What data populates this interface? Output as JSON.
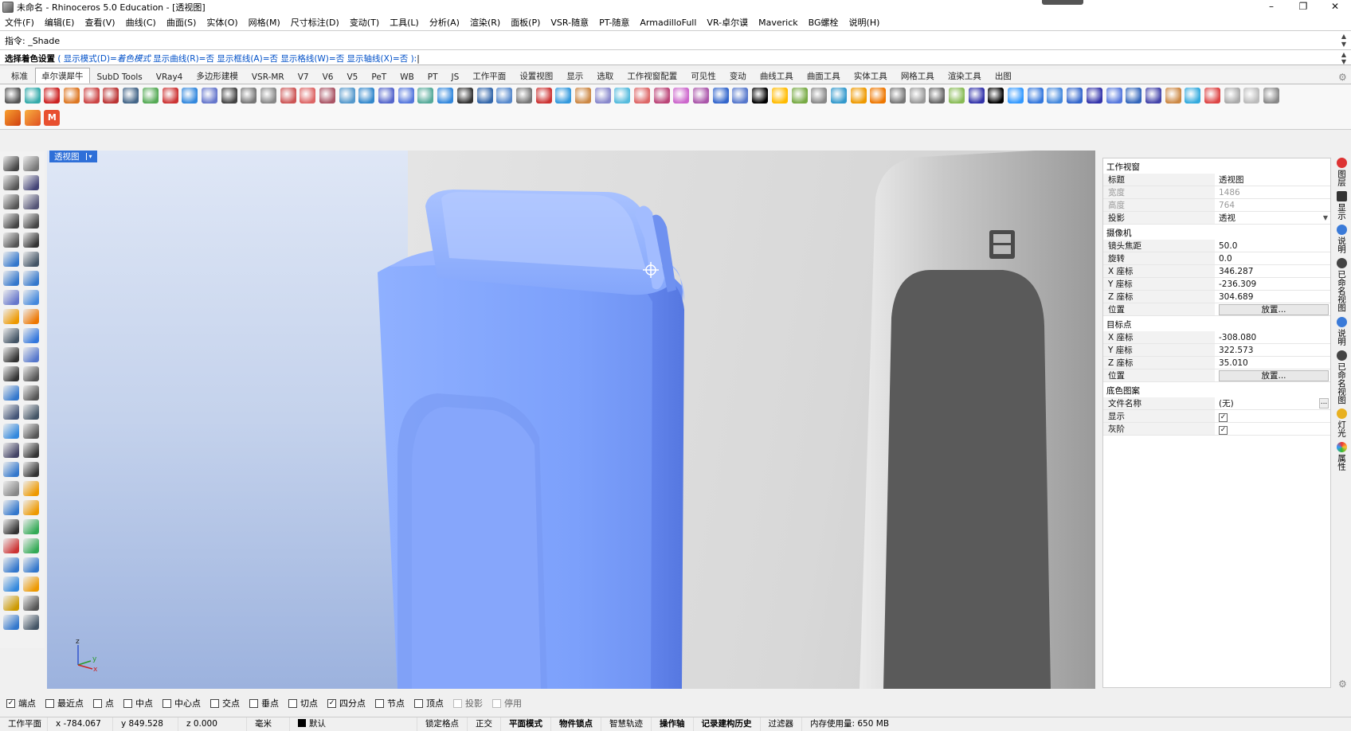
{
  "window": {
    "title": "未命名 - Rhinoceros 5.0 Education - [透视图]",
    "min": "–",
    "restore": "❐",
    "close": "✕"
  },
  "menu": [
    "文件(F)",
    "编辑(E)",
    "查看(V)",
    "曲线(C)",
    "曲面(S)",
    "实体(O)",
    "网格(M)",
    "尺寸标注(D)",
    "变动(T)",
    "工具(L)",
    "分析(A)",
    "渲染(R)",
    "面板(P)",
    "VSR-随意",
    "PT-随意",
    "ArmadilloFull",
    "VR-卓尔谟",
    "Maverick",
    "BG螺栓",
    "说明(H)"
  ],
  "command": {
    "history": "指令: _Shade",
    "prompt_label": "选择着色设置",
    "prompt_open": " ( 显示模式(D)=",
    "prompt_mode": "着色模式",
    "prompt_rest": "  显示曲线(R)=否  显示框线(A)=否  显示格线(W)=否  显示轴线(X)=否 ):"
  },
  "tabs": [
    "标准",
    "卓尔谟犀牛",
    "SubD Tools",
    "VRay4",
    "多边形建模",
    "VSR-MR",
    "V7",
    "V6",
    "V5",
    "PeT",
    "WB",
    "PT",
    "JS",
    "工作平面",
    "设置视图",
    "显示",
    "选取",
    "工作视窗配置",
    "可见性",
    "变动",
    "曲线工具",
    "曲面工具",
    "实体工具",
    "网格工具",
    "渲染工具",
    "出图"
  ],
  "active_tab": "卓尔谟犀牛",
  "viewport": {
    "name": "透视图",
    "dropdown": "▾",
    "axis_z": "z",
    "axis_y": "y",
    "axis_x": "x"
  },
  "properties": {
    "s_viewport": "工作视窗",
    "title_k": "标题",
    "title_v": "透视图",
    "width_k": "宽度",
    "width_v": "1486",
    "height_k": "高度",
    "height_v": "764",
    "proj_k": "投影",
    "proj_v": "透视",
    "s_camera": "摄像机",
    "lens_k": "镜头焦距",
    "lens_v": "50.0",
    "rot_k": "旋转",
    "rot_v": "0.0",
    "cx_k": "X 座标",
    "cx_v": "346.287",
    "cy_k": "Y 座标",
    "cy_v": "-236.309",
    "cz_k": "Z 座标",
    "cz_v": "304.689",
    "cpos_k": "位置",
    "cpos_btn": "放置...",
    "s_target": "目标点",
    "tx_k": "X 座标",
    "tx_v": "-308.080",
    "ty_k": "Y 座标",
    "ty_v": "322.573",
    "tz_k": "Z 座标",
    "tz_v": "35.010",
    "tpos_k": "位置",
    "tpos_btn": "放置...",
    "s_wall": "底色图案",
    "file_k": "文件名称",
    "file_v": "(无)",
    "file_more": "...",
    "show_k": "显示",
    "show_v": "✓",
    "gray_k": "灰阶",
    "gray_v": "✓"
  },
  "right_tabs": [
    "图层",
    "显示",
    "说明",
    "已命名视图",
    "说明",
    "已命名视图",
    "灯光",
    "属性"
  ],
  "snaps": [
    {
      "label": "端点",
      "checked": true,
      "mark": "✓"
    },
    {
      "label": "最近点",
      "checked": false,
      "mark": ""
    },
    {
      "label": "点",
      "checked": false,
      "mark": ""
    },
    {
      "label": "中点",
      "checked": false,
      "mark": ""
    },
    {
      "label": "中心点",
      "checked": false,
      "mark": ""
    },
    {
      "label": "交点",
      "checked": false,
      "mark": ""
    },
    {
      "label": "垂点",
      "checked": false,
      "mark": ""
    },
    {
      "label": "切点",
      "checked": false,
      "mark": ""
    },
    {
      "label": "四分点",
      "checked": true,
      "mark": "✓"
    },
    {
      "label": "节点",
      "checked": false,
      "mark": ""
    },
    {
      "label": "顶点",
      "checked": false,
      "mark": ""
    },
    {
      "label": "投影",
      "checked": false,
      "mark": "",
      "disabled": true
    },
    {
      "label": "停用",
      "checked": false,
      "mark": "",
      "disabled": true
    }
  ],
  "status": {
    "cplane": "工作平面",
    "x": "x -784.067",
    "y": "y 849.528",
    "z": "z 0.000",
    "unit": "毫米",
    "layer": "默认",
    "grid_snap": "锁定格点",
    "ortho": "正交",
    "planar": "平面模式",
    "osnap": "物件锁点",
    "smart": "智慧轨迹",
    "gumball": "操作轴",
    "history": "记录建构历史",
    "filter": "过滤器",
    "memory": "内存使用量: 650 MB"
  },
  "colors": {
    "accent": "#2e6fd8",
    "model": "#7e9ff5"
  }
}
